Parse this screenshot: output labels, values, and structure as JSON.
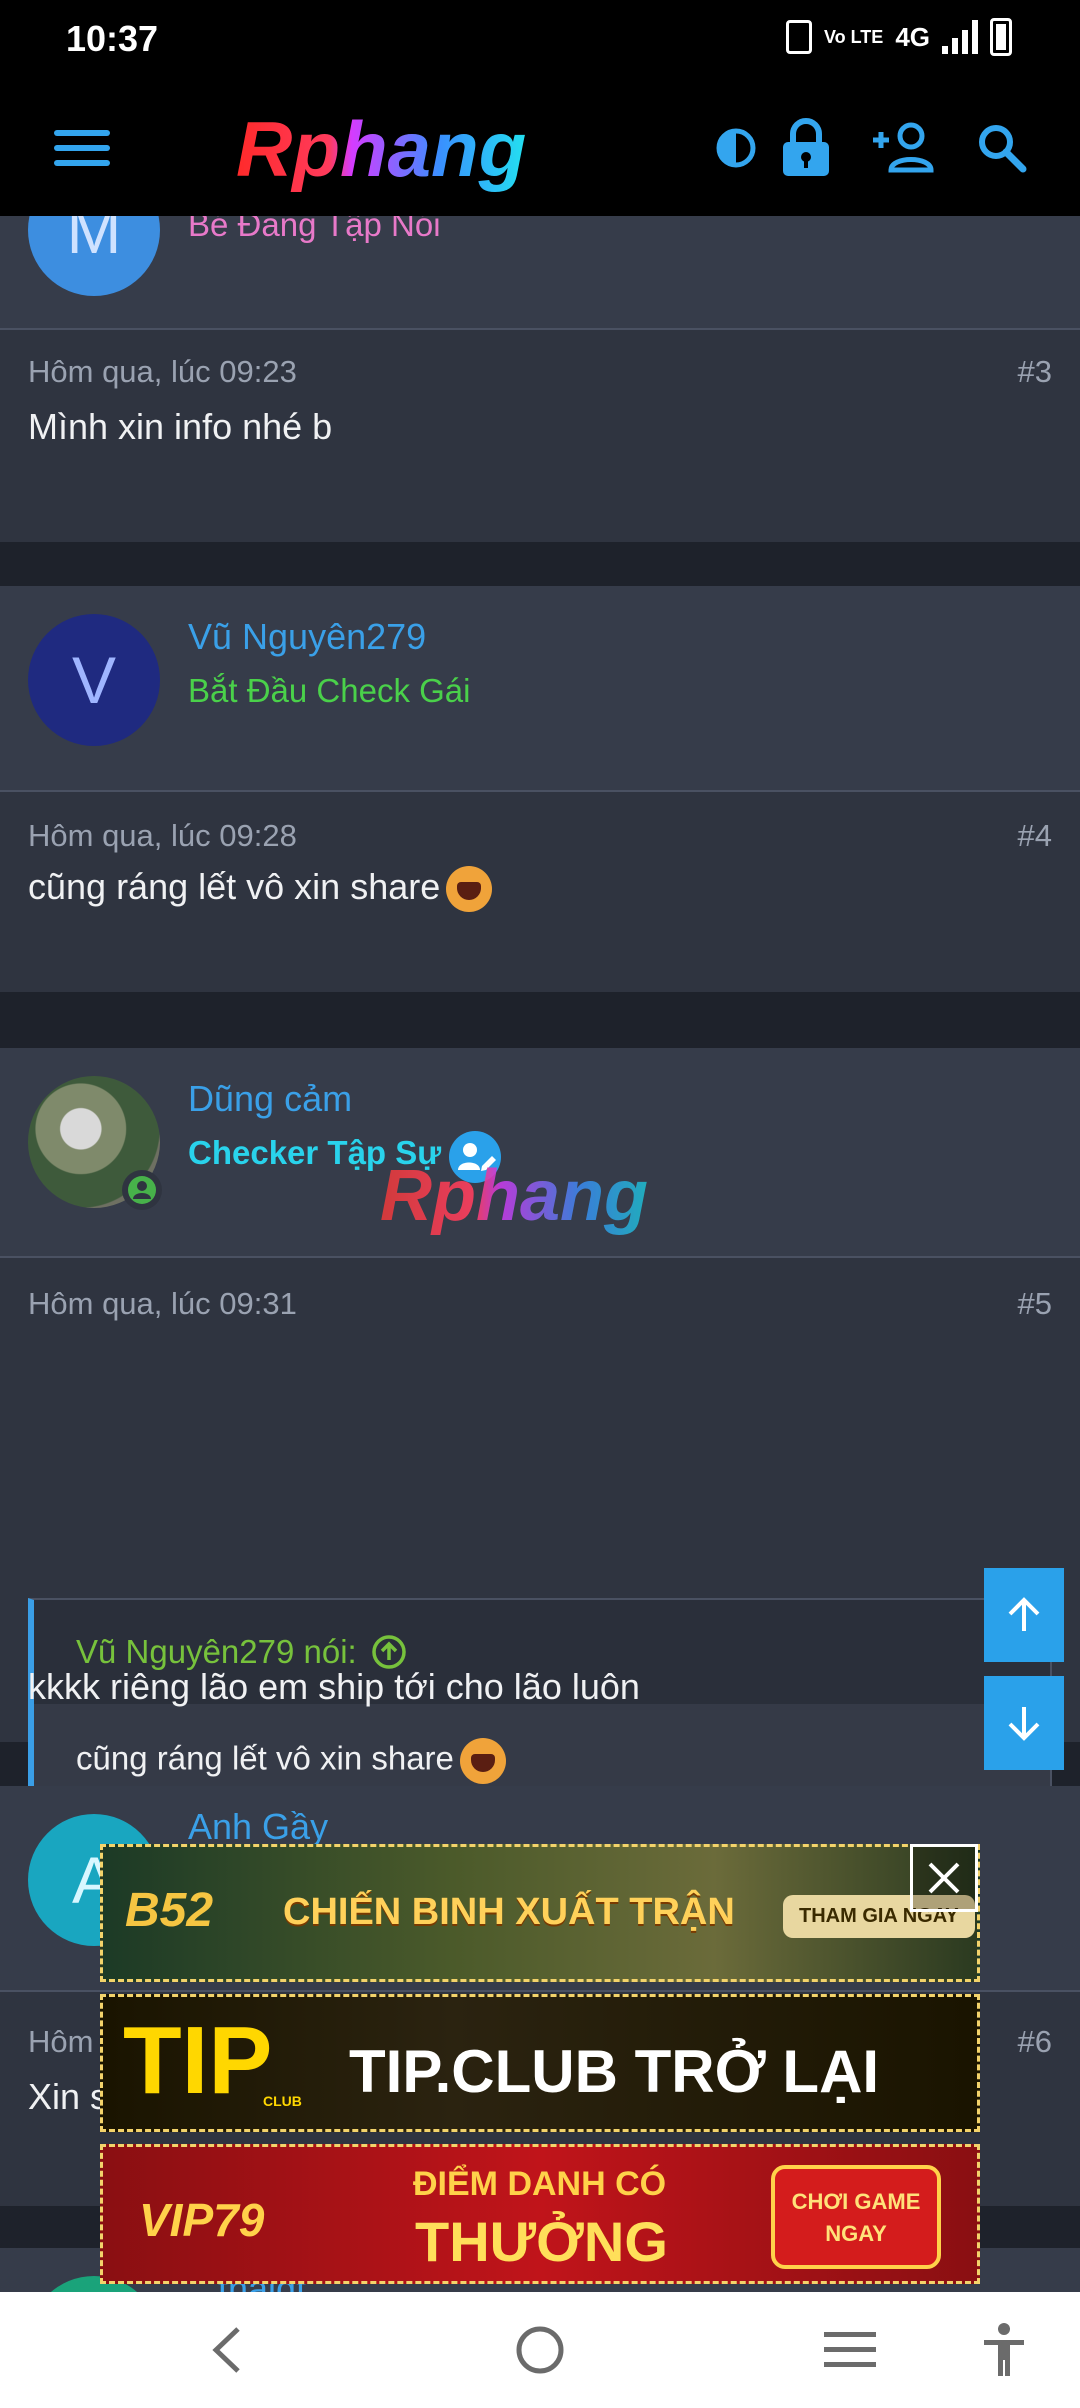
{
  "status_bar": {
    "time": "10:37",
    "network": "4G",
    "volte": "Vo LTE"
  },
  "header": {
    "logo_text": "Rphang",
    "icons": [
      "menu-icon",
      "contrast-icon",
      "lock-icon",
      "add-user-icon",
      "search-icon"
    ]
  },
  "posts": [
    {
      "avatar_letter": "M",
      "user_title": "Bé Đang Tập Nói",
      "timestamp": "Hôm qua, lúc 09:23",
      "post_number": "#3",
      "message": "Mình xin info nhé b"
    },
    {
      "avatar_letter": "V",
      "username": "Vũ Nguyên279",
      "user_title": "Bắt Đầu Check Gái",
      "timestamp": "Hôm qua, lúc 09:28",
      "post_number": "#4",
      "message": "cũng ráng lết vô xin share"
    },
    {
      "username": "Dũng cảm",
      "user_title": "Checker Tập Sự",
      "timestamp": "Hôm qua, lúc 09:31",
      "post_number": "#5",
      "quote": {
        "author": "Vũ Nguyên279 nói:",
        "text": "cũng ráng lết vô xin share"
      },
      "message": "kkkk riêng lão em ship tới cho lão luôn"
    },
    {
      "avatar_letter": "A",
      "username": "Anh Gầy",
      "timestamp": "Hôm",
      "post_number": "#6",
      "message": "Xin share với ạ"
    },
    {
      "username": "...thaidt"
    }
  ],
  "ads": [
    {
      "brand": "B52",
      "text": "CHIẾN BINH XUẤT TRẬN",
      "button": "THAM GIA NGAY"
    },
    {
      "brand": "TIP",
      "brand_sub": "CLUB",
      "text": "TIP.CLUB TRỞ LẠI"
    },
    {
      "brand": "VIP79",
      "text_top": "ĐIỂM DANH CÓ",
      "text_bottom": "THƯỞNG",
      "button_top": "CHƠI GAME",
      "button_bottom": "NGAY"
    }
  ],
  "colors": {
    "accent": "#2aa1ea",
    "background": "#1e222b",
    "card": "#2f3440",
    "card_header": "#363c4a",
    "pink_title": "#e879c9",
    "green_title": "#4ad14a",
    "cyan_title": "#29d3ec",
    "quote_author": "#77c23c"
  }
}
